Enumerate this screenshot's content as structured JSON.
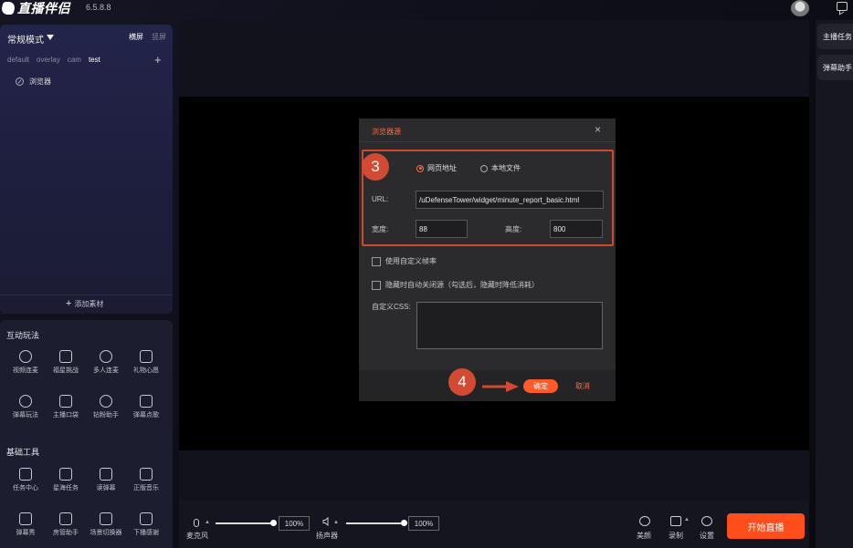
{
  "app": {
    "name": "直播伴侣",
    "version": "6.5.8.8"
  },
  "scene_panel": {
    "mode": "常规模式",
    "orientation_horizontal": "横屏",
    "orientation_vertical": "竖屏",
    "tabs": [
      "default",
      "overlay",
      "cam",
      "test"
    ],
    "active_tab": "test",
    "add_icon": "plus-icon",
    "sources": [
      {
        "label": "浏览器",
        "icon": "compass-icon"
      }
    ],
    "add_material": "添加素材"
  },
  "interactive": {
    "title": "互动玩法",
    "items": [
      {
        "label": "视频连麦",
        "icon": "mic-icon"
      },
      {
        "label": "福星挑战",
        "icon": "shield-star-icon"
      },
      {
        "label": "多人连麦",
        "icon": "multi-mic-icon"
      },
      {
        "label": "礼物心愿",
        "icon": "gift-icon"
      },
      {
        "label": "弹幕玩法",
        "icon": "eyes-icon"
      },
      {
        "label": "主播口袋",
        "icon": "pocket-icon"
      },
      {
        "label": "钻粉助手",
        "icon": "diamond-icon"
      },
      {
        "label": "弹幕点歌",
        "icon": "music-tv-icon"
      }
    ]
  },
  "tools": {
    "title": "基础工具",
    "items": [
      {
        "label": "任务中心",
        "icon": "clipboard-icon"
      },
      {
        "label": "星海任务",
        "icon": "ad-icon"
      },
      {
        "label": "读弹幕",
        "icon": "read-danmaku-icon"
      },
      {
        "label": "正版音乐",
        "icon": "music-icon"
      },
      {
        "label": "弹幕秀",
        "icon": "danmaku-show-icon"
      },
      {
        "label": "房管助手",
        "icon": "shield-icon"
      },
      {
        "label": "场景切换器",
        "icon": "switch-icon"
      },
      {
        "label": "下播感谢",
        "icon": "thanks-icon"
      }
    ]
  },
  "dialog": {
    "title": "浏览器源",
    "close": "×",
    "step3": "3",
    "step4": "4",
    "radio_web": "网页地址",
    "radio_local": "本地文件",
    "selected": "web",
    "url_label": "URL:",
    "url_value": "/uDefenseTower/widget/minute_report_basic.html",
    "width_label": "宽度:",
    "width_value": "88",
    "height_label": "高度:",
    "height_value": "800",
    "custom_fps": "使用自定义帧率",
    "auto_close": "隐藏时自动关闭源（勾选后，隐藏时降低消耗）",
    "css_label": "自定义CSS:",
    "css_value": "",
    "ok": "确定",
    "cancel": "取消",
    "accent": "#ff5a2a",
    "highlight": "#d2482f"
  },
  "right_panel": {
    "tasks": "主播任务",
    "danmaku": "弹幕助手"
  },
  "bottom_bar": {
    "mic_label": "麦克风",
    "mic_volume": "100%",
    "mic_level": 1.0,
    "speaker_label": "扬声器",
    "speaker_volume": "100%",
    "speaker_level": 1.0,
    "beauty": "美颜",
    "record": "录制",
    "settings": "设置",
    "go_live": "开始直播"
  }
}
